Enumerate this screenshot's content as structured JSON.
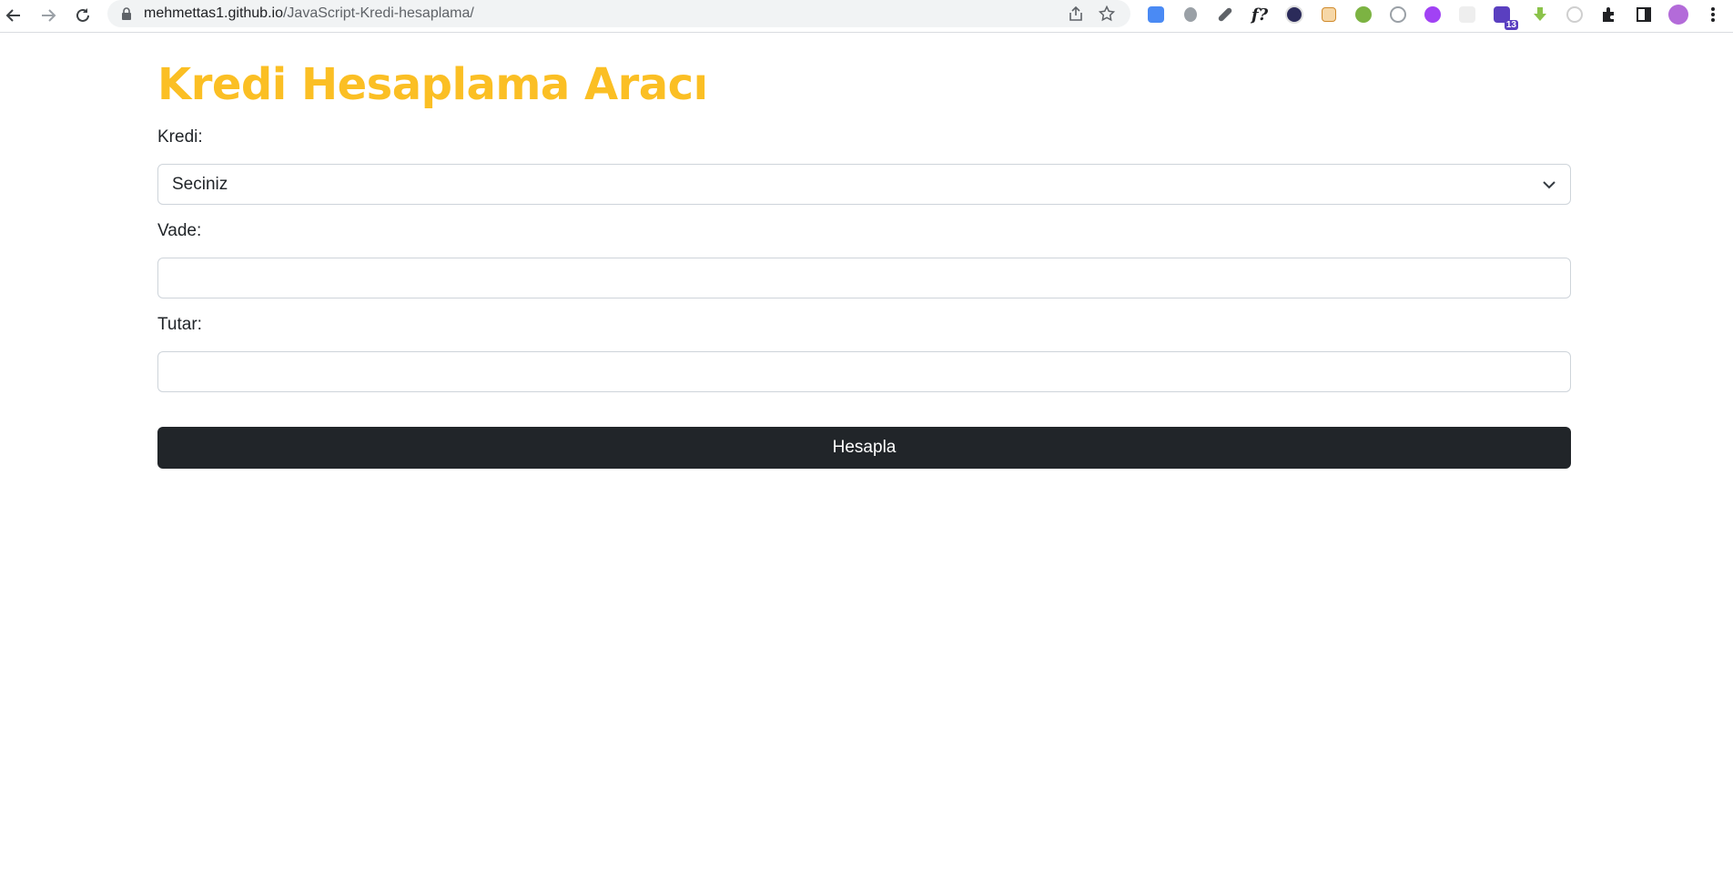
{
  "browser": {
    "url_host": "mehmettas1.github.io",
    "url_path": "/JavaScript-Kredi-hesaplama/",
    "extension_badge": "13",
    "icons": {
      "back": "arrow-left-icon",
      "forward": "arrow-right-icon",
      "reload": "reload-icon",
      "lock": "lock-icon",
      "share": "share-icon",
      "bookmark": "star-icon",
      "extensions": "puzzle-icon",
      "side_panel": "side-panel-icon",
      "menu": "kebab-menu-icon"
    }
  },
  "page": {
    "title": "Kredi Hesaplama Aracı",
    "colors": {
      "title": "#fbbf24",
      "button_bg": "#212529",
      "button_text": "#ffffff"
    },
    "form": {
      "kredi_label": "Kredi:",
      "kredi_selected": "Seciniz",
      "vade_label": "Vade:",
      "vade_value": "",
      "tutar_label": "Tutar:",
      "tutar_value": "",
      "submit_label": "Hesapla"
    }
  }
}
